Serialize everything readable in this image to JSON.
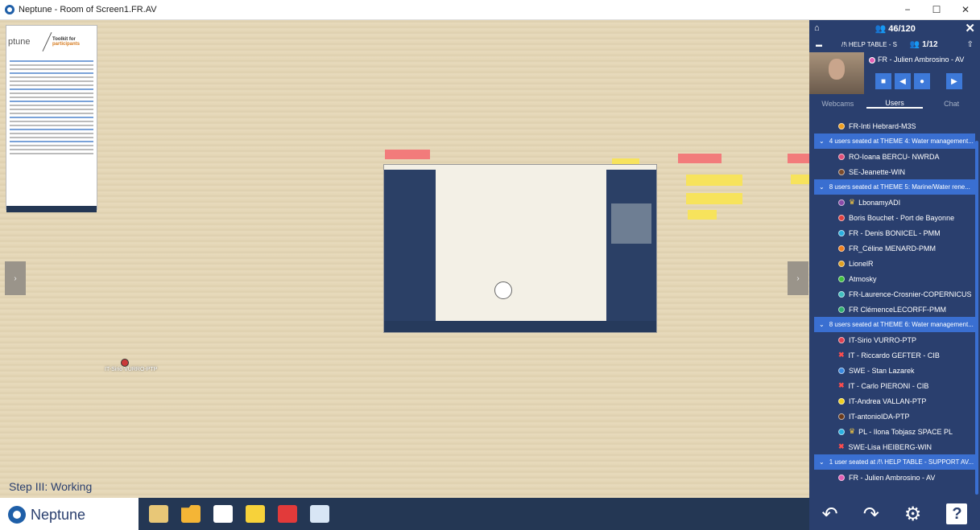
{
  "window": {
    "title": "Neptune - Room of Screen1.FR.AV",
    "controls": [
      "−",
      "☐",
      "✕"
    ]
  },
  "board": {
    "step_label": "Step III: Working",
    "doc_panel": {
      "logo": "ptune",
      "heading": "Toolkit for",
      "subheading": "participants"
    },
    "user_marker_label": "IT-Sirio VURRO-PTP",
    "left_arrow": "›",
    "right_arrow": "›"
  },
  "right_panel": {
    "room_count": "46/120",
    "table_name": "/!\\ HELP TABLE - S",
    "table_count": "1/12",
    "me_name": "FR - Julien Ambrosino - AV",
    "tabs": [
      {
        "label": "Webcams"
      },
      {
        "label": "Users"
      },
      {
        "label": "Chat"
      }
    ],
    "items": [
      {
        "kind": "user",
        "name": "FR-Inti Hebrard-M3S",
        "color": "#f0a020"
      },
      {
        "kind": "group",
        "name": "4 users seated at THEME 4: Water management..."
      },
      {
        "kind": "user",
        "name": "RO-Ioana BERCU- NWRDA",
        "color": "#e0507a"
      },
      {
        "kind": "user",
        "name": "SE-Jeanette-WIN",
        "color": "#7a4a2a"
      },
      {
        "kind": "group",
        "name": "8 users seated at THEME 5: Marine/Water rene..."
      },
      {
        "kind": "user",
        "name": "LbonamyADI",
        "color": "#8a4aa8",
        "crown": true
      },
      {
        "kind": "user",
        "name": "Boris Bouchet - Port de Bayonne",
        "color": "#e04040"
      },
      {
        "kind": "user",
        "name": "FR - Denis BONICEL - PMM",
        "color": "#2ab0e0"
      },
      {
        "kind": "user",
        "name": "FR_Céline MENARD-PMM",
        "color": "#f08020"
      },
      {
        "kind": "user",
        "name": "LionelR",
        "color": "#e0a020"
      },
      {
        "kind": "user",
        "name": "Atmosky",
        "color": "#40c040"
      },
      {
        "kind": "user",
        "name": "FR-Laurence-Crosnier-COPERNICUS",
        "color": "#40c0c0"
      },
      {
        "kind": "user",
        "name": "FR ClémenceLECORFF-PMM",
        "color": "#30b070"
      },
      {
        "kind": "group",
        "name": "8 users seated at THEME 6: Water management..."
      },
      {
        "kind": "user",
        "name": "IT-Sirio VURRO-PTP",
        "color": "#e04050"
      },
      {
        "kind": "user",
        "name": "IT - Riccardo GEFTER - CIB",
        "color": "",
        "xmark": true
      },
      {
        "kind": "user",
        "name": "SWE - Stan Lazarek",
        "color": "#3a8ae0"
      },
      {
        "kind": "user",
        "name": "IT - Carlo PIERONI - CIB",
        "color": "",
        "xmark": true
      },
      {
        "kind": "user",
        "name": "IT-Andrea VALLAN-PTP",
        "color": "#f0d020"
      },
      {
        "kind": "user",
        "name": "IT-antonioIDA-PTP",
        "color": "#6a3a1a"
      },
      {
        "kind": "user",
        "name": "PL - Ilona Tobjasz SPACE PL",
        "color": "#2ab0e0",
        "crown": true
      },
      {
        "kind": "user",
        "name": "SWE-Lisa HEIBERG-WIN",
        "color": "",
        "xmark": true
      },
      {
        "kind": "group",
        "name": "1 user seated at /!\\ HELP TABLE - SUPPORT AV..."
      },
      {
        "kind": "user",
        "name": "FR - Julien Ambrosino - AV",
        "color": "#e35fb5"
      }
    ]
  },
  "bottom": {
    "brand": "Neptune",
    "tools": [
      "chest-icon",
      "folder-icon",
      "card-icon",
      "sticky-note-icon",
      "screen-share-icon",
      "list-icon"
    ],
    "actions": [
      "undo-icon",
      "redo-icon",
      "settings-icon",
      "help-icon"
    ],
    "help_label": "?"
  }
}
